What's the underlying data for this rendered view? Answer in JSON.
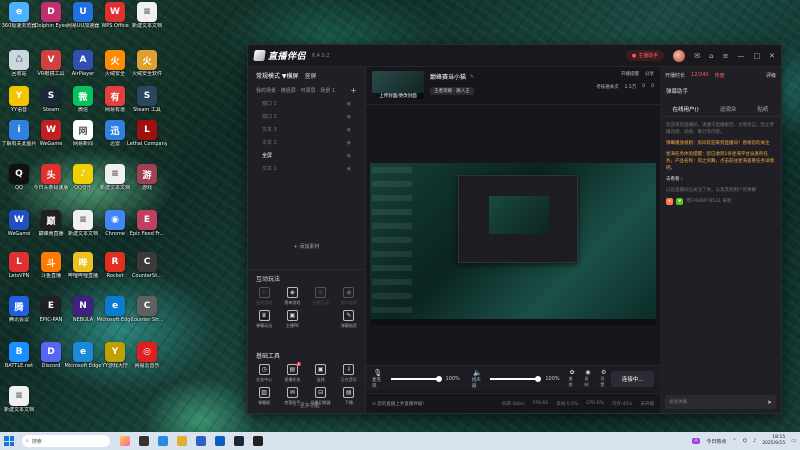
{
  "desktop": {
    "icons": [
      {
        "label": "360极速浏览器",
        "color": "#4fb0ff",
        "glyph": "e"
      },
      {
        "label": "Dolphin Eyes",
        "color": "#c03070",
        "glyph": "D"
      },
      {
        "label": "网易UU加速器",
        "color": "#2070e0",
        "glyph": "U"
      },
      {
        "label": "WPS Office",
        "color": "#e03030",
        "glyph": "W"
      },
      {
        "label": "新建文本文档",
        "color": "#f0f0f0",
        "glyph": "≡"
      },
      {
        "label": "回收站",
        "color": "#ccd6e0",
        "glyph": "♺"
      },
      {
        "label": "VR眼镜工具",
        "color": "#d04040",
        "glyph": "V"
      },
      {
        "label": "AirPlayer",
        "color": "#3050b0",
        "glyph": "A"
      },
      {
        "label": "火绒安全",
        "color": "#ff8c00",
        "glyph": "火"
      },
      {
        "label": "火绒安全软件",
        "color": "#e0a030",
        "glyph": "火"
      },
      {
        "label": "YY语音",
        "color": "#f2c500",
        "glyph": "Y"
      },
      {
        "label": "Steam",
        "color": "#1b2838",
        "glyph": "S"
      },
      {
        "label": "微信",
        "color": "#07c160",
        "glyph": "微"
      },
      {
        "label": "网易有道",
        "color": "#e04040",
        "glyph": "有"
      },
      {
        "label": "Steam 工具",
        "color": "#2a475e",
        "glyph": "S"
      },
      {
        "label": "了解有关此图片",
        "color": "#3080e0",
        "glyph": "i"
      },
      {
        "label": "WeGame",
        "color": "#c02020",
        "glyph": "W"
      },
      {
        "label": "网易新闻",
        "color": "#ffffff",
        "glyph": "网"
      },
      {
        "label": "迅雷",
        "color": "#3080e0",
        "glyph": "迅"
      },
      {
        "label": "Lethal Company",
        "color": "#a01010",
        "glyph": "L"
      },
      {
        "label": "QQ",
        "color": "#111111",
        "glyph": "Q"
      },
      {
        "label": "今日头条极速版",
        "color": "#e03030",
        "glyph": "头"
      },
      {
        "label": "QQ音乐",
        "color": "#f0d000",
        "glyph": "♪"
      },
      {
        "label": "新建文本文档",
        "color": "#f0f0f0",
        "glyph": "≡"
      },
      {
        "label": "游戏",
        "color": "#a04050",
        "glyph": "游"
      },
      {
        "label": "WeGame",
        "color": "#2050c0",
        "glyph": "W"
      },
      {
        "label": "巅峰赛直播",
        "color": "#202020",
        "glyph": "巅"
      },
      {
        "label": "新建文本文档",
        "color": "#f0f0f0",
        "glyph": "≡"
      },
      {
        "label": "Chrome",
        "color": "#4285f4",
        "glyph": "◉"
      },
      {
        "label": "Epic Feed Fr...",
        "color": "#c04060",
        "glyph": "E"
      },
      {
        "label": "LetsVPN",
        "color": "#e03030",
        "glyph": "L"
      },
      {
        "label": "斗鱼直播",
        "color": "#ff7a00",
        "glyph": "斗"
      },
      {
        "label": "哔哩哔哩直播",
        "color": "#f0c020",
        "glyph": "哔"
      },
      {
        "label": "Rocket",
        "color": "#e03020",
        "glyph": "R"
      },
      {
        "label": "CounterSt...",
        "color": "#3a3a3a",
        "glyph": "C"
      },
      {
        "label": "腾讯会议",
        "color": "#2060e0",
        "glyph": "腾"
      },
      {
        "label": "EPIC-PAN",
        "color": "#202020",
        "glyph": "E"
      },
      {
        "label": "NEBULA",
        "color": "#402080",
        "glyph": "N"
      },
      {
        "label": "Microsoft Edge",
        "color": "#0a7cd0",
        "glyph": "e"
      },
      {
        "label": "Counter Str...",
        "color": "#606060",
        "glyph": "C"
      },
      {
        "label": "BATTLE.net",
        "color": "#1890ff",
        "glyph": "B"
      },
      {
        "label": "Discord",
        "color": "#5865f2",
        "glyph": "D"
      },
      {
        "label": "Microsoft Edge",
        "color": "#1a8ad8",
        "glyph": "e"
      },
      {
        "label": "YY游戏大厅",
        "color": "#c0a000",
        "glyph": "Y"
      },
      {
        "label": "网易云音乐",
        "color": "#e02020",
        "glyph": "◎"
      },
      {
        "label": "新建文本文档",
        "color": "#f0f0f0",
        "glyph": "≡"
      }
    ]
  },
  "app": {
    "title": "直播伴侣",
    "version": "6.4.0.2",
    "record_label": "主播助手",
    "mode": {
      "label": "常规模式 ▼",
      "horizontal": "横屏",
      "vertical": "竖屏"
    },
    "scene_header": {
      "label": "我的场景 · 横竖屏 · 可录屏 · 场景 1",
      "add": "+"
    },
    "scenes": [
      {
        "label": "窗口 1",
        "active": false
      },
      {
        "label": "窗口 2",
        "active": false
      },
      {
        "label": "文本 3",
        "active": false
      },
      {
        "label": "文本 2",
        "active": false
      },
      {
        "label": "全屏",
        "active": true
      },
      {
        "label": "文本 1",
        "active": false
      }
    ],
    "add_material": "+ 添加素材",
    "interactive": {
      "title": "互动玩法",
      "tools": [
        {
          "label": "连线游戏",
          "glyph": "◇",
          "dim": true
        },
        {
          "label": "榜单游戏",
          "glyph": "◈",
          "dim": false
        },
        {
          "label": "礼物互动",
          "glyph": "◎",
          "dim": true
        },
        {
          "label": "观众连线",
          "glyph": "◉",
          "dim": true
        },
        {
          "label": "弹幕玩法",
          "glyph": "♛",
          "dim": false
        },
        {
          "label": "主播PK",
          "glyph": "▣",
          "dim": false
        },
        {
          "label": "",
          "glyph": "",
          "dim": true
        },
        {
          "label": "弹幕抽奖",
          "glyph": "✎",
          "dim": false
        }
      ]
    },
    "basic_tools": {
      "title": "基础工具",
      "tools": [
        {
          "label": "任务中心",
          "glyph": "◷",
          "badge": ""
        },
        {
          "label": "直播任务",
          "glyph": "▤",
          "badge": "1"
        },
        {
          "label": "连线",
          "glyph": "▣",
          "badge": ""
        },
        {
          "label": "正在音乐",
          "glyph": "⇩",
          "badge": ""
        },
        {
          "label": "弹幕姬",
          "glyph": "▥",
          "badge": ""
        },
        {
          "label": "房管助手",
          "glyph": "✉",
          "badge": ""
        },
        {
          "label": "场景切换器",
          "glyph": "⊟",
          "badge": ""
        },
        {
          "label": "下播",
          "glyph": "▤",
          "badge": ""
        }
      ]
    },
    "more_functions": "⋯ 更多功能",
    "room": {
      "thumb_label": "上传封面/更改封面",
      "title": "巅峰赛当小猫",
      "tags": [
        "王者荣耀 · 路人王"
      ],
      "follow": "开播提醒",
      "share": "分享",
      "stats": [
        "考核通关次",
        "2.5万",
        "0",
        "0"
      ]
    },
    "mixer": {
      "mic_label": "麦克风",
      "mic_value": "100%",
      "mic_level": 1.0,
      "speaker_label": "扬声器",
      "speaker_value": "100%",
      "speaker_level": 1.0,
      "beauty": "美颜",
      "record": "录制",
      "settings": "设置",
      "start": "连接中..."
    },
    "status": {
      "notice": "⊙ 您的直播上手直播件级!",
      "items": [
        "码率:0kb/s",
        "FPS:60",
        "丢帧:0.0%",
        "CPU:6%",
        "内存:45%",
        "未开播"
      ]
    },
    "right_panel": {
      "header": {
        "time": "开播时长",
        "count": "12/240",
        "hot": "热度",
        "grade": "评级"
      },
      "assistant_title": "弹幕助手",
      "tabs": [
        {
          "label": "在线用户()",
          "active": true
        },
        {
          "label": "送观众",
          "active": false
        },
        {
          "label": "贴纸",
          "active": false
        }
      ],
      "chat": [
        {
          "text": "欢迎来到直播间，请遵守直播规范，文明发言。禁止传播违规、低俗、暴力等内容。",
          "type": "system"
        },
        {
          "text": "弹幕播放规则：房间欢迎来到直播间！感谢您的关注",
          "type": "orange"
        },
        {
          "text": "星海任务体验提醒：您已收到1条星海平台派发的任务，产品名称：风之剑舞，点击前往星海查看任务详情吧。",
          "type": "orange"
        },
        {
          "text": "去看看 ›",
          "type": "link"
        },
        {
          "text": "以前直播间已关注了你，以及其他用户的弹幕",
          "type": "system"
        },
        {
          "user": "用户686978531 来啦",
          "type": "user"
        }
      ],
      "input_placeholder": "发送弹幕..."
    }
  },
  "taskbar": {
    "search_placeholder": "搜索",
    "weather": "今日热点",
    "time": "18:15",
    "date": "2025/9/15"
  }
}
